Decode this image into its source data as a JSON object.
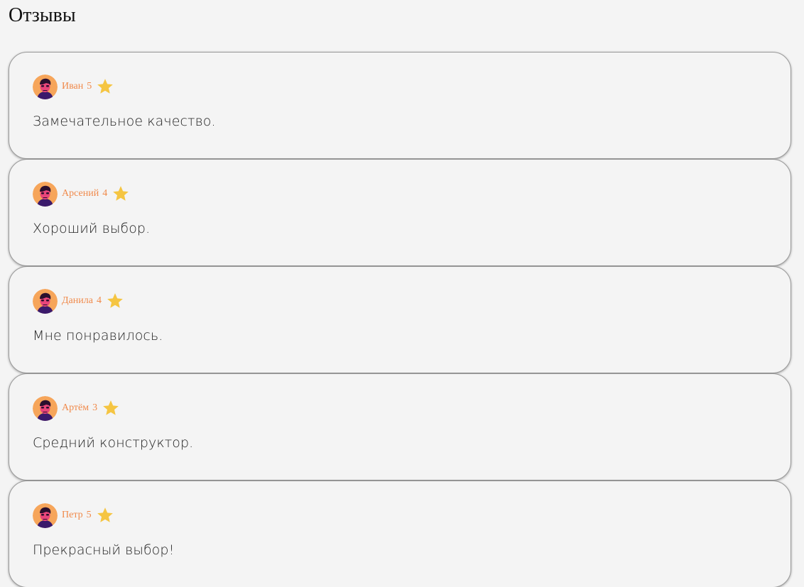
{
  "page": {
    "title": "Отзывы"
  },
  "colors": {
    "author": "#f08a4b",
    "star": "#f5c542",
    "background": "#f4f4f4"
  },
  "reviews": [
    {
      "author": "Иван",
      "rating": "5",
      "text": "Замечательное качество.",
      "avatar_icon": "user-avatar-icon",
      "star_icon": "star-icon"
    },
    {
      "author": "Арсений",
      "rating": "4",
      "text": "Хороший выбор.",
      "avatar_icon": "user-avatar-icon",
      "star_icon": "star-icon"
    },
    {
      "author": "Данила",
      "rating": "4",
      "text": "Мне понравилось.",
      "avatar_icon": "user-avatar-icon",
      "star_icon": "star-icon"
    },
    {
      "author": "Артём",
      "rating": "3",
      "text": "Средний конструктор.",
      "avatar_icon": "user-avatar-icon",
      "star_icon": "star-icon"
    },
    {
      "author": "Петр",
      "rating": "5",
      "text": "Прекрасный выбор!",
      "avatar_icon": "user-avatar-icon",
      "star_icon": "star-icon"
    }
  ]
}
